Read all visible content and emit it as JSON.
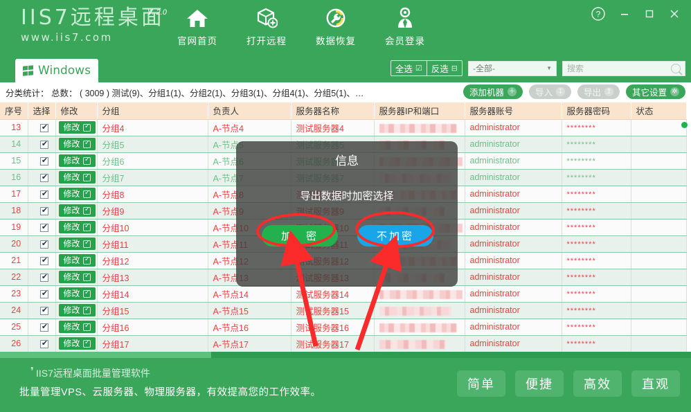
{
  "window": {
    "logo_main": "IIS7远程桌面",
    "logo_version": "V. 2.0",
    "logo_url": "www.iis7.com",
    "controls": {
      "help": "?",
      "minimize": "–",
      "maximize": "▫",
      "close": "✕"
    }
  },
  "topnav": [
    {
      "label": "官网首页",
      "icon": "home-icon"
    },
    {
      "label": "打开远程",
      "icon": "box-plus-icon"
    },
    {
      "label": "数据恢复",
      "icon": "wrench-recover-icon"
    },
    {
      "label": "会员登录",
      "icon": "user-login-icon"
    }
  ],
  "tab": {
    "label": "Windows",
    "icon": "windows-flag-icon"
  },
  "toolbar": {
    "select_all": "全选",
    "invert_select": "反选",
    "filter_value": "-全部-",
    "search_placeholder": "搜索",
    "search_value": ""
  },
  "stats": {
    "text": "分类统计： 总数： ( 3009 ) 测试(9)、分组1(1)、分组2(1)、分组3(1)、分组4(1)、分组5(1)、…",
    "actions": [
      {
        "label": "添加机器",
        "icon": "plus-circle-icon",
        "style": "green"
      },
      {
        "label": "导入",
        "icon": "import-icon",
        "style": "gray"
      },
      {
        "label": "导出",
        "icon": "export-icon",
        "style": "gray"
      },
      {
        "label": "其它设置",
        "icon": "gear-icon",
        "style": "green"
      }
    ]
  },
  "table": {
    "columns": [
      "序号",
      "选择",
      "修改",
      "分组",
      "负责人",
      "服务器名称",
      "服务器IP和端口",
      "服务器账号",
      "服务器密码",
      "状态"
    ],
    "edit_label": "修改",
    "password_mask": "********",
    "account_value": "administrator",
    "rows": [
      {
        "no": "13",
        "checked": true,
        "group": "分组4",
        "owner": "A-节点4",
        "server": "测试服务器4",
        "ip": "mosaic",
        "account": "administrator",
        "password": "********",
        "status": "",
        "color": "red",
        "band": "A"
      },
      {
        "no": "14",
        "checked": true,
        "group": "分组5",
        "owner": "A-节点5",
        "server": "测试服务器5",
        "ip": "mosaic",
        "account": "administrator",
        "password": "********",
        "status": "",
        "color": "green",
        "band": "B"
      },
      {
        "no": "15",
        "checked": true,
        "group": "分组6",
        "owner": "A-节点6",
        "server": "测试服务器6",
        "ip": "mosaic",
        "account": "administrator",
        "password": "********",
        "status": "",
        "color": "green",
        "band": "A"
      },
      {
        "no": "16",
        "checked": true,
        "group": "分组7",
        "owner": "A-节点7",
        "server": "测试服务器7",
        "ip": "mosaic",
        "account": "administrator",
        "password": "********",
        "status": "",
        "color": "green",
        "band": "B"
      },
      {
        "no": "17",
        "checked": true,
        "group": "分组8",
        "owner": "A-节点8",
        "server": "测试服务器8",
        "ip": "mosaic",
        "account": "administrator",
        "password": "********",
        "status": "",
        "color": "red",
        "band": "A"
      },
      {
        "no": "18",
        "checked": true,
        "group": "分组9",
        "owner": "A-节点9",
        "server": "测试服务器9",
        "ip": "mosaic",
        "account": "administrator",
        "password": "********",
        "status": "",
        "color": "red",
        "band": "B"
      },
      {
        "no": "19",
        "checked": true,
        "group": "分组10",
        "owner": "A-节点10",
        "server": "测试服务器10",
        "ip": "mosaic",
        "account": "administrator",
        "password": "********",
        "status": "",
        "color": "red",
        "band": "A"
      },
      {
        "no": "20",
        "checked": true,
        "group": "分组11",
        "owner": "A-节点11",
        "server": "测试服务器11",
        "ip": "mosaic",
        "account": "administrator",
        "password": "********",
        "status": "",
        "color": "red",
        "band": "B"
      },
      {
        "no": "21",
        "checked": true,
        "group": "分组12",
        "owner": "A-节点12",
        "server": "测试服务器12",
        "ip": "mosaic",
        "account": "administrator",
        "password": "********",
        "status": "",
        "color": "red",
        "band": "A"
      },
      {
        "no": "22",
        "checked": true,
        "group": "分组13",
        "owner": "A-节点13",
        "server": "测试服务器13",
        "ip": "mosaic",
        "account": "administrator",
        "password": "********",
        "status": "",
        "color": "red",
        "band": "B"
      },
      {
        "no": "23",
        "checked": true,
        "group": "分组14",
        "owner": "A-节点14",
        "server": "测试服务器14",
        "ip": "mosaic",
        "account": "administrator",
        "password": "********",
        "status": "",
        "color": "red",
        "band": "A"
      },
      {
        "no": "24",
        "checked": true,
        "group": "分组15",
        "owner": "A-节点15",
        "server": "测试服务器15",
        "ip": "mosaic",
        "account": "administrator",
        "password": "********",
        "status": "",
        "color": "red",
        "band": "B"
      },
      {
        "no": "25",
        "checked": true,
        "group": "分组16",
        "owner": "A-节点16",
        "server": "测试服务器16",
        "ip": "mosaic",
        "account": "administrator",
        "password": "********",
        "status": "",
        "color": "red",
        "band": "A"
      },
      {
        "no": "26",
        "checked": true,
        "group": "分组17",
        "owner": "A-节点17",
        "server": "测试服务器17",
        "ip": "mosaic",
        "account": "administrator",
        "password": "********",
        "status": "",
        "color": "red",
        "band": "B"
      }
    ]
  },
  "modal": {
    "title": "信息",
    "message": "导出数据时加密选择",
    "encrypt_label": "加　密",
    "no_encrypt_label": "不加密"
  },
  "footer": {
    "line1": "IIS7远程桌面批量管理软件",
    "line2": "批量管理VPS、云服务器、物理服务器，有效提高您的工作效率。",
    "tags": [
      "简单",
      "便捷",
      "高效",
      "直观"
    ]
  },
  "colors": {
    "brand_green": "#3aa65a",
    "header_peach": "#fae4cd",
    "row_red_text": "#e8423f",
    "row_green_text": "#6cbf86",
    "modal_encrypt": "#22b14c",
    "modal_no_encrypt": "#18a6e8",
    "annotation_red": "#fb2b2b"
  }
}
